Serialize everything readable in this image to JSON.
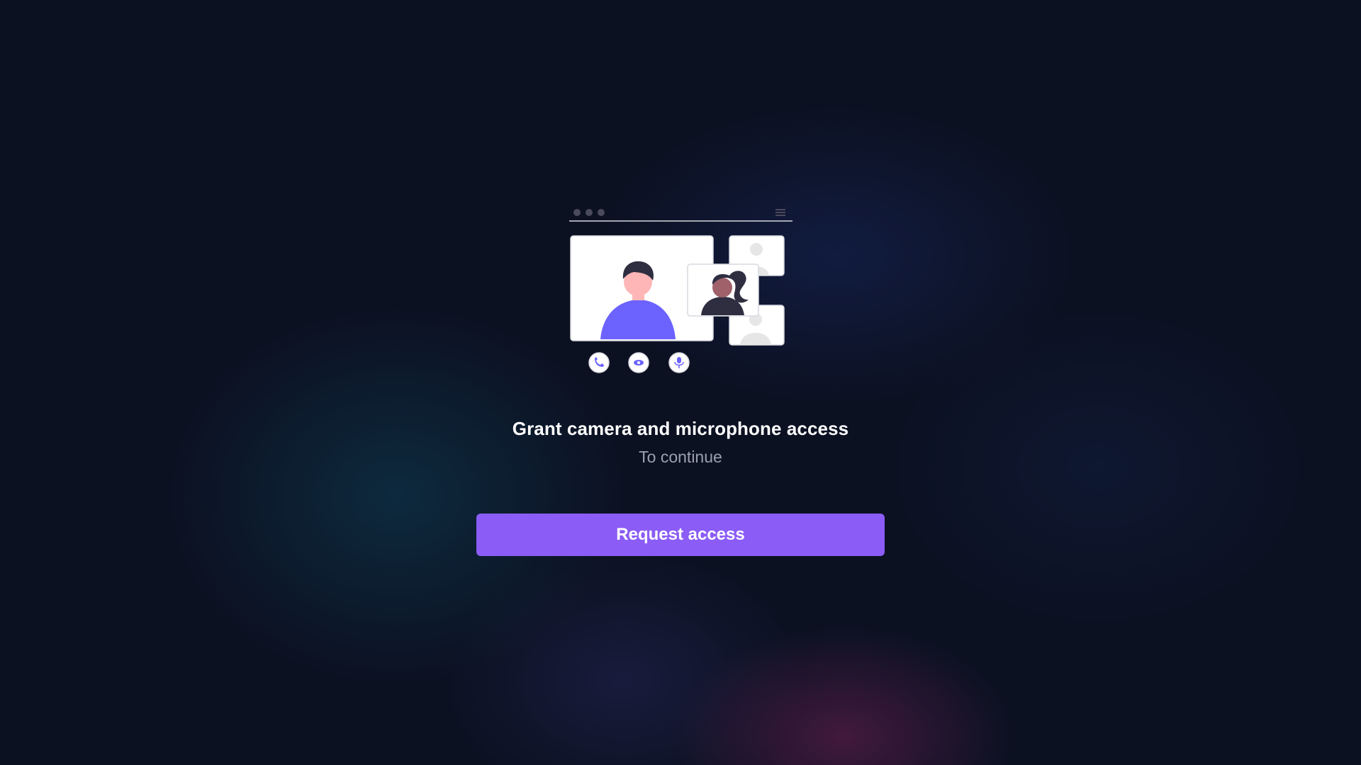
{
  "permission": {
    "title": "Grant camera and microphone access",
    "subtitle": "To continue",
    "button_label": "Request access"
  },
  "illustration": {
    "window_dots": [
      "dot",
      "dot",
      "dot"
    ],
    "menu_icon": "menu-icon",
    "controls": [
      "phone-icon",
      "eye-icon",
      "microphone-icon"
    ]
  },
  "colors": {
    "background": "#0c1122",
    "accent": "#8b5cf6",
    "avatar_shirt": "#6c63ff",
    "skin": "#ffb6b6",
    "hair": "#2f2e41",
    "placeholder_gray": "#e6e6e6"
  }
}
